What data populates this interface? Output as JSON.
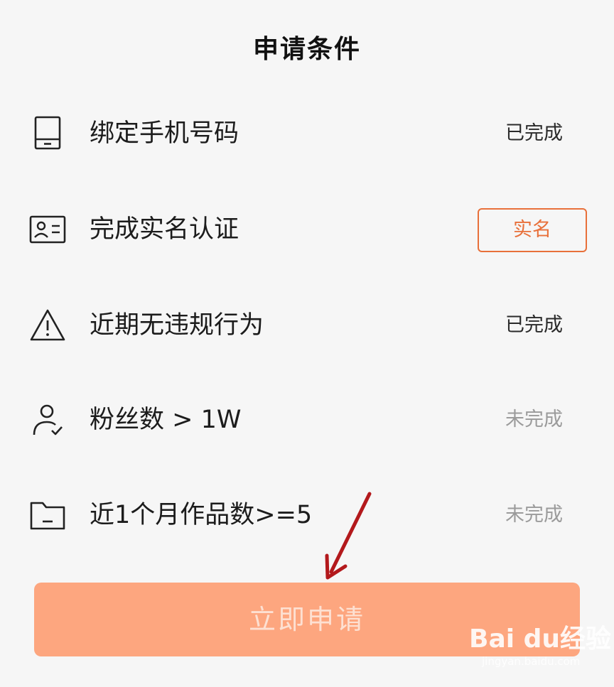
{
  "page": {
    "title": "申请条件"
  },
  "conditions": [
    {
      "icon": "phone-icon",
      "label": "绑定手机号码",
      "status": "已完成",
      "state": "done"
    },
    {
      "icon": "id-card-icon",
      "label": "完成实名认证",
      "action_label": "实名",
      "state": "action"
    },
    {
      "icon": "warning-icon",
      "label": "近期无违规行为",
      "status": "已完成",
      "state": "done"
    },
    {
      "icon": "user-check-icon",
      "label": "粉丝数 > 1W",
      "status": "未完成",
      "state": "todo"
    },
    {
      "icon": "folder-icon",
      "label": "近1个月作品数>=5",
      "status": "未完成",
      "state": "todo"
    }
  ],
  "apply_button": {
    "label": "立即申请"
  },
  "watermark": {
    "brand": "Bai du经验",
    "url": "jingyan.baidu.com"
  },
  "colors": {
    "accent": "#e8703a",
    "apply_button_bg": "#fda67f",
    "status_done": "#2a2a2a",
    "status_todo": "#9b9b9b",
    "annotation_arrow": "#b3191c"
  }
}
